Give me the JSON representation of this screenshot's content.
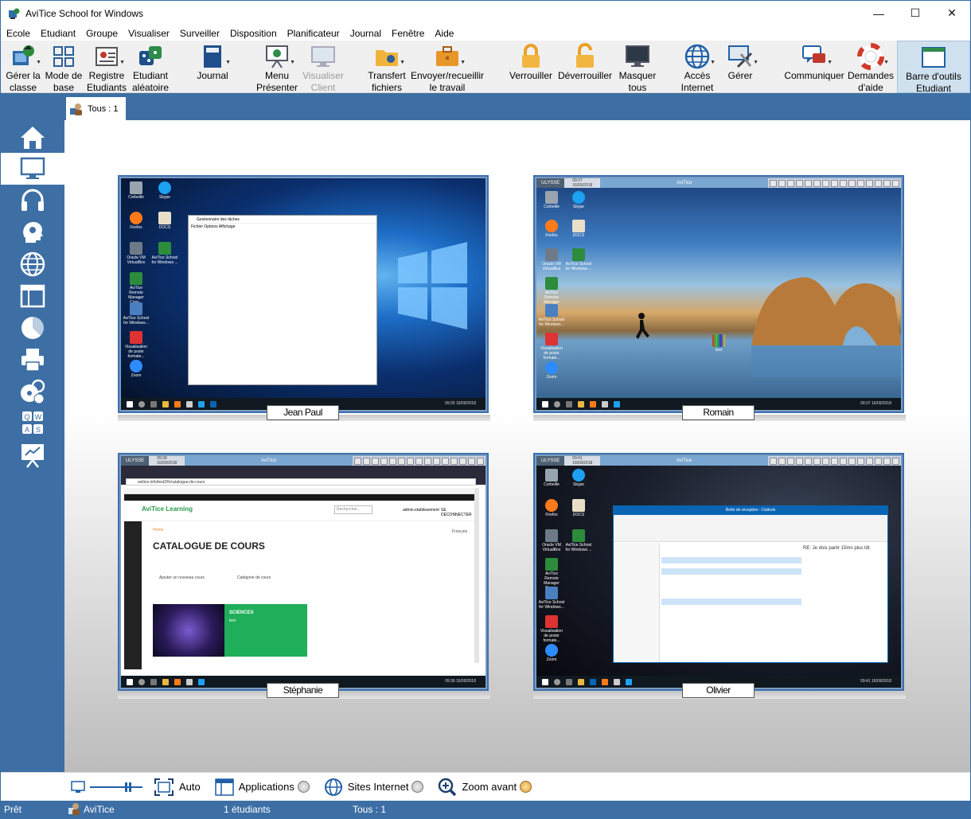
{
  "window": {
    "title": "AviTice School for Windows",
    "minimize_icon": "minimize-icon",
    "maximize_icon": "maximize-icon",
    "close_icon": "close-icon"
  },
  "menu": [
    "Ecole",
    "Etudiant",
    "Groupe",
    "Visualiser",
    "Surveiller",
    "Disposition",
    "Planificateur",
    "Journal",
    "Fenêtre",
    "Aide"
  ],
  "toolbar": {
    "manage_class": {
      "line1": "Gérer la",
      "line2": "classe",
      "icon": "manage-class-icon"
    },
    "base_mode": {
      "line1": "Mode de",
      "line2": "base",
      "icon": "grid-mode-icon"
    },
    "register": {
      "line1": "Registre",
      "line2": "Etudiants",
      "icon": "register-icon"
    },
    "random": {
      "line1": "Etudiant",
      "line2": "aléatoire",
      "icon": "dice-icon"
    },
    "journal": {
      "line1": "Journal",
      "line2": "",
      "icon": "book-icon"
    },
    "present": {
      "line1": "Menu",
      "line2": "Présenter",
      "icon": "presentation-icon"
    },
    "view_client": {
      "line1": "Visualiser",
      "line2": "Client",
      "icon": "view-client-icon"
    },
    "transfer": {
      "line1": "Transfert",
      "line2": "fichiers",
      "icon": "folder-transfer-icon"
    },
    "send_collect": {
      "line1": "Envoyer/recueillir",
      "line2": "le travail",
      "icon": "briefcase-icon"
    },
    "lock": {
      "line1": "Verrouiller",
      "line2": "",
      "icon": "lock-icon"
    },
    "unlock": {
      "line1": "Déverrouiller",
      "line2": "",
      "icon": "unlock-icon"
    },
    "hide_all": {
      "line1": "Masquer",
      "line2": "tous",
      "icon": "monitor-icon"
    },
    "internet": {
      "line1": "Accès",
      "line2": "Internet",
      "icon": "globe-icon"
    },
    "manage": {
      "line1": "Gérer",
      "line2": "",
      "icon": "tools-icon"
    },
    "communicate": {
      "line1": "Communiquer",
      "line2": "",
      "icon": "chat-icon"
    },
    "help": {
      "line1": "Demandes",
      "line2": "d'aide",
      "icon": "lifebuoy-icon"
    },
    "student_toolbar": {
      "line1": "Barre d'outils",
      "line2": "Etudiant",
      "icon": "window-icon"
    }
  },
  "sidebar": [
    {
      "name": "home-icon"
    },
    {
      "name": "monitor-icon"
    },
    {
      "name": "headphones-icon"
    },
    {
      "name": "head-icon"
    },
    {
      "name": "globe-icon"
    },
    {
      "name": "layout-icon"
    },
    {
      "name": "pie-chart-icon"
    },
    {
      "name": "printer-icon"
    },
    {
      "name": "media-icon"
    },
    {
      "name": "keyboard-icon"
    },
    {
      "name": "whiteboard-icon"
    }
  ],
  "tab": {
    "label": "Tous : 1"
  },
  "students": [
    {
      "name": "Jean Paul"
    },
    {
      "name": "Romain"
    },
    {
      "name": "Stéphanie"
    },
    {
      "name": "Olivier"
    }
  ],
  "screens": {
    "jeanpaul": {
      "icons": [
        "Corbeille",
        "Skype",
        "Firefox",
        "DOCS",
        "Oracle VM VirtualBox",
        "AviTice School for Windows ...",
        "AviTice Remote Manager Cons...",
        "AviTice School for Windows...",
        "Visualisation de poste formate...",
        "Zoom"
      ],
      "window_title": "Gestionnaire des tâches",
      "window_menu": "Fichier   Options   Affichage",
      "clock": "09:25\n16/09/2018"
    },
    "romain": {
      "bar_left": "ULYSSE",
      "bar_time": "09:37\n16/09/2018",
      "bar_mid": "AviTice",
      "icons": [
        "Corbeille",
        "Skype",
        "Firefox",
        "DOCS",
        "Oracle VM VirtualBox",
        "AviTice School for Windows ...",
        "AviTice Remote Manager Cons...",
        "AviTice School for Windows...",
        "Visualisation de poste formate...",
        "Zoom"
      ],
      "center_icon": "test",
      "clock": "09:37\n16/09/2018"
    },
    "stephanie": {
      "bar_left": "ULYSSE",
      "bar_time": "09:39\n16/09/2018",
      "bar_mid": "AviTice",
      "url": "avitice.info/test2/fr/catalogue-de-cours",
      "site_logo": "AviTice Learning",
      "search_placeholder": "Rechercher...",
      "admin_link": "admin.etablissement",
      "logout": "SE DÉCONNECTER",
      "breadcrumb": "Home",
      "lang": "Français",
      "heading": "CATALOGUE DE COURS",
      "add_course": "Ajouter un nouveau cours",
      "category": "Catégorie de cours",
      "card_title": "SCIENCES",
      "card_sub": "test",
      "clock": "09:39\n16/09/2018"
    },
    "olivier": {
      "bar_left": "ULYSSE",
      "bar_time": "09:41\n16/09/2018",
      "bar_mid": "AviTice",
      "icons": [
        "Corbeille",
        "Skype",
        "Firefox",
        "DOCS",
        "Oracle VM VirtualBox",
        "AviTice School for Windows ...",
        "AviTice Remote Manager Cons...",
        "AviTice School for Windows...",
        "Visualisation de poste formate...",
        "Zoom"
      ],
      "outlook_title": "Boîte de réception - Outlook",
      "outlook_subject": "RE: Je dois partir 15mn plus tôt",
      "clock": "09:41\n16/09/2018"
    }
  },
  "bottombar": {
    "auto": "Auto",
    "applications": "Applications",
    "sites": "Sites Internet",
    "zoom": "Zoom avant",
    "zoom_selected": true
  },
  "statusbar": {
    "ready": "Prêt",
    "app": "AviTice",
    "count": "1 étudiants",
    "group": "Tous : 1"
  },
  "colors": {
    "accent": "#3d6fa5",
    "thumb_border": "#3a6fb0"
  }
}
